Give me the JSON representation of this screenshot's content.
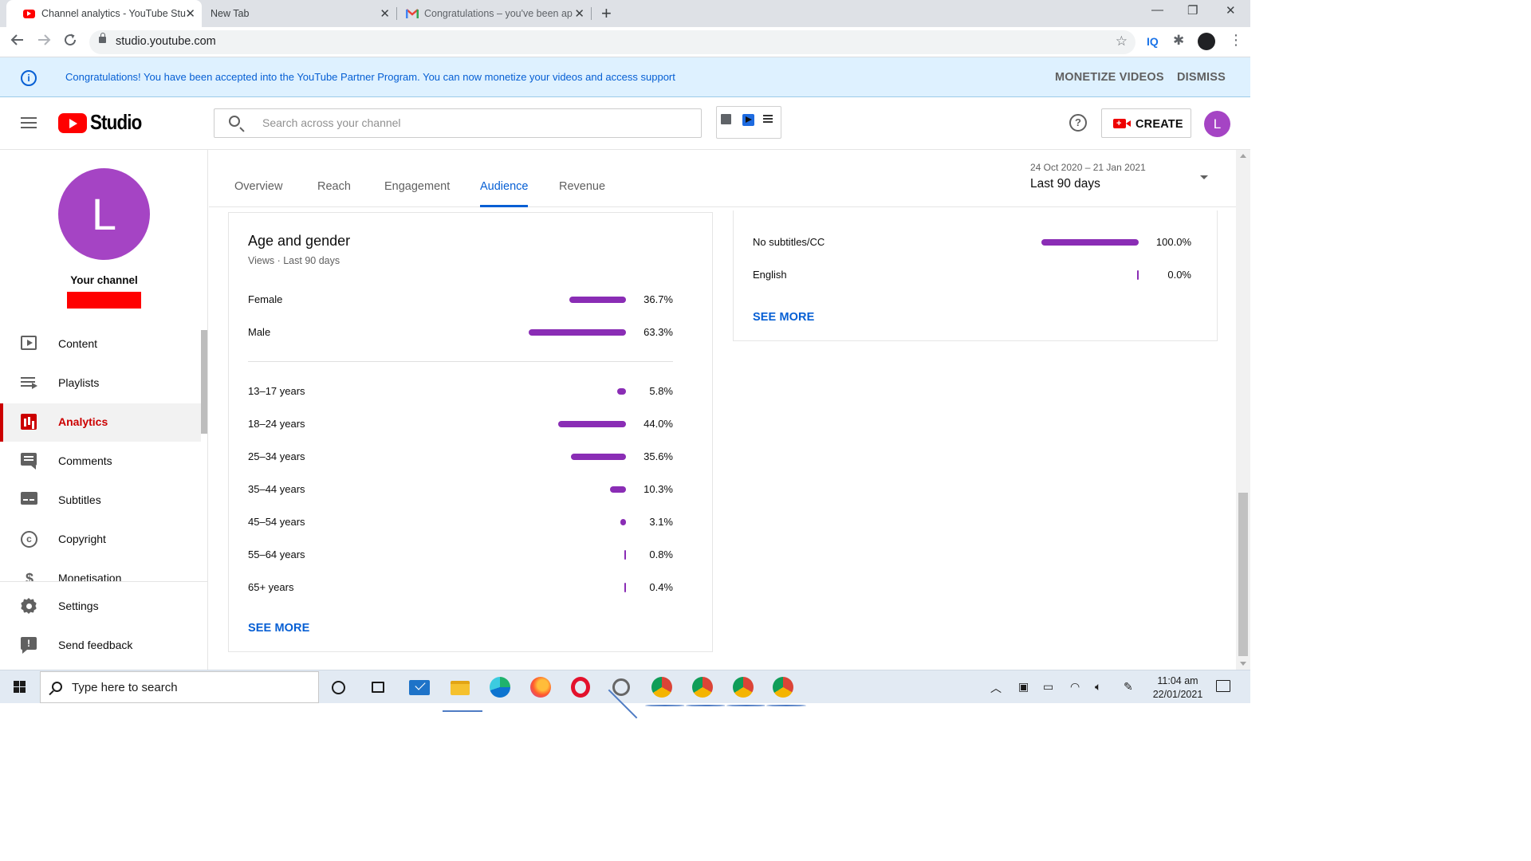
{
  "browser": {
    "tabs": [
      {
        "title": "Channel analytics - YouTube Stu",
        "active": true
      },
      {
        "title": "New Tab",
        "active": false
      },
      {
        "title": "Congratulations – you've been ap",
        "active": false
      }
    ],
    "new_tab_symbol": "+",
    "close_symbol": "✕",
    "url": "studio.youtube.com",
    "window_controls": {
      "minimize": "—",
      "maximize": "❐",
      "close": "✕"
    },
    "extensions": {
      "iq_label": "IQ"
    }
  },
  "banner": {
    "message": "Congratulations! You have been accepted into the YouTube Partner Program. You can now monetize your videos and access support",
    "monetize_label": "MONETIZE VIDEOS",
    "dismiss_label": "DISMISS",
    "info_symbol": "i"
  },
  "header": {
    "logo_text": "Studio",
    "search_placeholder": "Search across your channel",
    "help_symbol": "?",
    "create_label": "CREATE",
    "avatar_letter": "L"
  },
  "sidebar": {
    "avatar_letter": "L",
    "channel_label": "Your channel",
    "items": [
      {
        "label": "Content",
        "icon": "content-icon",
        "active": false
      },
      {
        "label": "Playlists",
        "icon": "playlists-icon",
        "active": false
      },
      {
        "label": "Analytics",
        "icon": "analytics-icon",
        "active": true
      },
      {
        "label": "Comments",
        "icon": "comments-icon",
        "active": false
      },
      {
        "label": "Subtitles",
        "icon": "subtitles-icon",
        "active": false
      },
      {
        "label": "Copyright",
        "icon": "copyright-icon",
        "active": false
      },
      {
        "label": "Monetisation",
        "icon": "monetisation-icon",
        "active": false
      }
    ],
    "footer_items": [
      {
        "label": "Settings",
        "icon": "gear-icon"
      },
      {
        "label": "Send feedback",
        "icon": "feedback-icon"
      }
    ],
    "copyright_symbol": "c",
    "money_symbol": "$"
  },
  "analytics": {
    "tabs": [
      "Overview",
      "Reach",
      "Engagement",
      "Audience",
      "Revenue"
    ],
    "active_tab": "Audience",
    "date_range": "24 Oct 2020 – 21 Jan 2021",
    "period_label": "Last 90 days"
  },
  "age_gender_card": {
    "title": "Age and gender",
    "subtitle": "Views · Last 90 days",
    "gender": [
      {
        "label": "Female",
        "value": "36.7%",
        "fraction": 0.367
      },
      {
        "label": "Male",
        "value": "63.3%",
        "fraction": 0.633
      }
    ],
    "age": [
      {
        "label": "13–17 years",
        "value": "5.8%",
        "fraction": 0.058
      },
      {
        "label": "18–24 years",
        "value": "44.0%",
        "fraction": 0.44
      },
      {
        "label": "25–34 years",
        "value": "35.6%",
        "fraction": 0.356
      },
      {
        "label": "35–44 years",
        "value": "10.3%",
        "fraction": 0.103
      },
      {
        "label": "45–54 years",
        "value": "3.1%",
        "fraction": 0.031
      },
      {
        "label": "55–64 years",
        "value": "0.8%",
        "fraction": 0.008
      },
      {
        "label": "65+ years",
        "value": "0.4%",
        "fraction": 0.004
      }
    ],
    "see_more": "SEE MORE"
  },
  "subtitles_card": {
    "rows": [
      {
        "label": "No subtitles/CC",
        "value": "100.0%",
        "fraction": 1.0
      },
      {
        "label": "English",
        "value": "0.0%",
        "fraction": 0.0
      }
    ],
    "see_more": "SEE MORE"
  },
  "taskbar": {
    "search_placeholder": "Type here to search",
    "time": "11:04 am",
    "date": "22/01/2021"
  },
  "colors": {
    "bar": "#8a2db5",
    "accent_blue": "#065fd4",
    "youtube_red": "#ff0000",
    "active_nav": "#cc0000",
    "avatar": "#a544c4"
  }
}
